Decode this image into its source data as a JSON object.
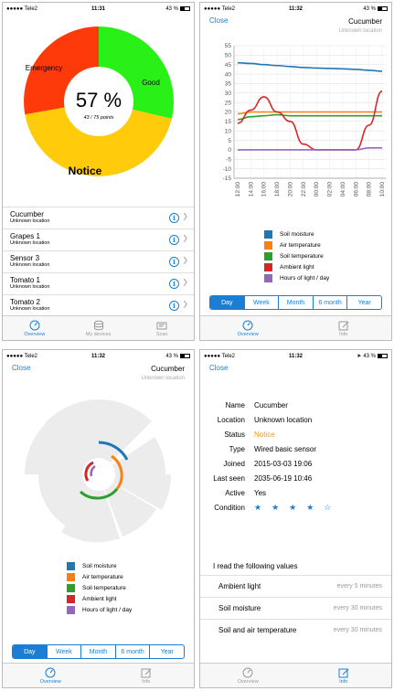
{
  "status": {
    "carrier": "●●●●● Tele2",
    "battery": "43 %"
  },
  "times": {
    "p1": "11:31",
    "p2": "11:32",
    "p3": "11:32",
    "p4": "11:32"
  },
  "close_label": "Close",
  "device": {
    "name": "Cucumber",
    "location": "Unknown location"
  },
  "overview": {
    "percent": "57 %",
    "points": "43 / 75 points",
    "segments": {
      "emergency": "Emergency",
      "good": "Good",
      "notice": "Notice"
    },
    "colors": {
      "emergency": "#ff3a0a",
      "good": "#29f117",
      "notice": "#ffcb0a"
    }
  },
  "devices": [
    {
      "name": "Cucumber",
      "location": "Unknown location"
    },
    {
      "name": "Grapes 1",
      "location": "Unknown location"
    },
    {
      "name": "Sensor 3",
      "location": "Unknown location"
    },
    {
      "name": "Tomato 1",
      "location": "Unknown location"
    },
    {
      "name": "Tomato 2",
      "location": "Unknown location"
    }
  ],
  "tabs": {
    "overview": "Overview",
    "my_devices": "My devices",
    "scan": "Scan",
    "info": "Info"
  },
  "ranges": [
    "Day",
    "Week",
    "Month",
    "6 month",
    "Year"
  ],
  "legend": [
    {
      "label": "Soil moisture",
      "color": "#1f77b4"
    },
    {
      "label": "Air temperature",
      "color": "#ff7f0e"
    },
    {
      "label": "Soil temperature",
      "color": "#2ca02c"
    },
    {
      "label": "Ambient light",
      "color": "#d62728"
    },
    {
      "label": "Hours of light / day",
      "color": "#9467bd"
    }
  ],
  "chart_data": {
    "type": "line",
    "x": [
      "12:00",
      "14:00",
      "16:00",
      "18:00",
      "20:00",
      "22:00",
      "00:00",
      "02:00",
      "04:00",
      "06:00",
      "08:00",
      "10:00"
    ],
    "ylim": [
      -15,
      55
    ],
    "yticks": [
      55,
      50,
      45,
      40,
      35,
      30,
      25,
      20,
      15,
      10,
      5,
      0,
      -5,
      -10,
      -15
    ],
    "grid": true,
    "series": [
      {
        "name": "Soil moisture",
        "color": "#1f77b4",
        "values": [
          46,
          45.6,
          45,
          44.5,
          44,
          43.5,
          43.2,
          43,
          42.8,
          42.5,
          42,
          41.5
        ]
      },
      {
        "name": "Air temperature",
        "color": "#ff7f0e",
        "values": [
          19,
          20,
          20,
          20,
          20,
          20,
          20,
          20,
          20,
          20,
          20,
          20
        ]
      },
      {
        "name": "Soil temperature",
        "color": "#2ca02c",
        "values": [
          16,
          17.5,
          18,
          18.5,
          18,
          18,
          18,
          18,
          18,
          18,
          18,
          18
        ]
      },
      {
        "name": "Ambient light",
        "color": "#d62728",
        "values": [
          14,
          21,
          28,
          20,
          15,
          3,
          0,
          0,
          0,
          0,
          13,
          31
        ]
      },
      {
        "name": "Hours of light / day",
        "color": "#9467bd",
        "values": [
          0,
          0,
          0,
          0,
          0,
          0,
          0,
          0,
          0,
          0,
          1,
          1
        ]
      }
    ]
  },
  "info": {
    "rows": [
      {
        "key": "Name",
        "value": "Cucumber"
      },
      {
        "key": "Location",
        "value": "Unknown location"
      },
      {
        "key": "Status",
        "value": "Notice",
        "color": "#ff9500"
      },
      {
        "key": "Type",
        "value": "Wired basic sensor"
      },
      {
        "key": "Joined",
        "value": "2015-03-03 19:06"
      },
      {
        "key": "Last seen",
        "value": "2035-06-19 10:46"
      },
      {
        "key": "Active",
        "value": "Yes"
      }
    ],
    "condition_label": "Condition",
    "stars": 4,
    "stars_max": 5,
    "readings_title": "I read the following values",
    "readings": [
      {
        "name": "Ambient light",
        "interval": "every 5 minutes"
      },
      {
        "name": "Soil moisture",
        "interval": "every 30 minutes"
      },
      {
        "name": "Soil and air temperature",
        "interval": "every 30 minutes"
      }
    ]
  }
}
